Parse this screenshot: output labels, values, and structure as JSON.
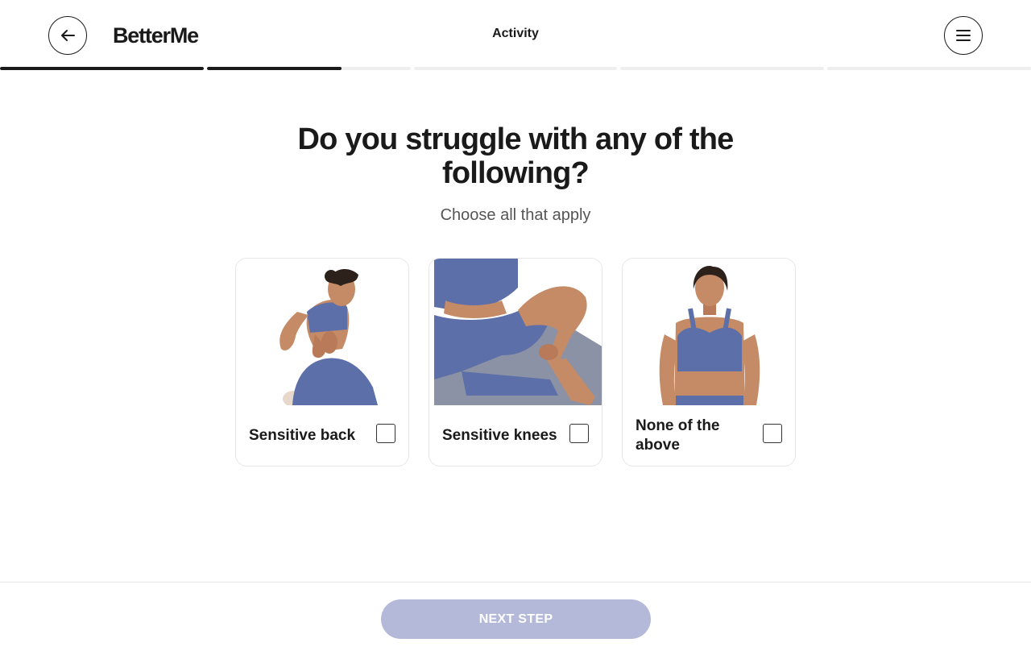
{
  "header": {
    "logo": "BetterMe",
    "section_title": "Activity"
  },
  "progress": {
    "segments": [
      1.0,
      0.66,
      0.0,
      0.0,
      0.0
    ]
  },
  "question": {
    "title": "Do you struggle with any of the following?",
    "subtitle": "Choose all that apply"
  },
  "options": [
    {
      "label": "Sensitive back",
      "checked": false,
      "image": "woman-holding-lower-back"
    },
    {
      "label": "Sensitive knees",
      "checked": false,
      "image": "woman-holding-knee-on-mat"
    },
    {
      "label": "None of the above",
      "checked": false,
      "image": "woman-standing-portrait"
    }
  ],
  "footer": {
    "next_label": "NEXT STEP"
  },
  "colors": {
    "text": "#1a1a1a",
    "button_disabled": "#b4b9d9",
    "outfit": "#5d6fa8",
    "progress_fill": "#1a1a1a",
    "progress_track": "#eeeeee"
  },
  "icons": {
    "back": "arrow-left-icon",
    "menu": "hamburger-menu-icon"
  }
}
